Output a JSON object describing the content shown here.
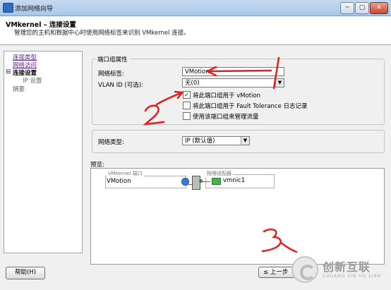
{
  "window": {
    "title": "添加网络向导",
    "min": "─",
    "max": "▢",
    "close": "✕"
  },
  "header": {
    "title": "VMkernel – 连接设置",
    "subtitle": "管理您的主机和数据中心时使用网络标签来识别 VMkernel 连接。"
  },
  "nav": {
    "items": [
      {
        "label": "连接类型"
      },
      {
        "label": "网络访问"
      },
      {
        "label": "连接设置"
      },
      {
        "label": "IP 设置"
      },
      {
        "label": "摘要"
      }
    ]
  },
  "port_group": {
    "legend": "端口组属性",
    "network_label_caption": "网络标签:",
    "network_label_value": "VMotion",
    "vlan_caption": "VLAN ID (可选):",
    "vlan_value": "无(0)",
    "checkboxes": [
      {
        "label": "将此端口组用于 vMotion",
        "checked": true,
        "mark": "✓"
      },
      {
        "label": "将此端口组用于 Fault Tolerance 日志记录",
        "checked": false,
        "mark": ""
      },
      {
        "label": "使用该端口组来管理流量",
        "checked": false,
        "mark": ""
      }
    ]
  },
  "network_type": {
    "caption": "网络类型:",
    "value": "IP (默认值)"
  },
  "preview": {
    "label": "预览:",
    "vmkernel_box_title": "VMkernel 端口",
    "vmkernel_port_name": "VMotion",
    "adapter_box_title": "物理适配器",
    "adapter_name": "vmnic1"
  },
  "buttons": {
    "help": "帮助(H)",
    "back": "≤ 上一步"
  },
  "annotations": {
    "n1": "1",
    "n2": "2",
    "n3": "3"
  },
  "watermark": {
    "name": "创新互联",
    "sub": "CHUANG XIN HU LIAN"
  },
  "colors": {
    "annotation_red": "#e02020",
    "link": "#6a1b9a"
  }
}
